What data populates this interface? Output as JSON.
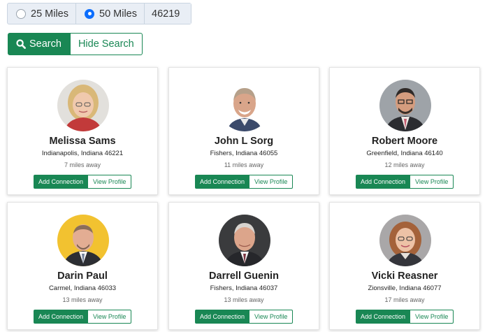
{
  "search_radius": {
    "options": [
      {
        "label": "25 Miles",
        "selected": false
      },
      {
        "label": "50 Miles",
        "selected": true
      }
    ],
    "zip_value": "46219"
  },
  "search_buttons": {
    "search_label": "Search",
    "hide_label": "Hide Search",
    "search_icon": "search-icon"
  },
  "colors": {
    "accent_green": "#198754",
    "radio_blue": "#0d6efd"
  },
  "results": [
    {
      "name": "Melissa Sams",
      "location": "Indianapolis, Indiana 46221",
      "distance": "7 miles away",
      "add_label": "Add Connection",
      "view_label": "View Profile"
    },
    {
      "name": "John L Sorg",
      "location": "Fishers, Indiana 46055",
      "distance": "11 miles away",
      "add_label": "Add Connection",
      "view_label": "View Profile"
    },
    {
      "name": "Robert Moore",
      "location": "Greenfield, Indiana 46140",
      "distance": "12 miles away",
      "add_label": "Add Connection",
      "view_label": "View Profile"
    },
    {
      "name": "Darin Paul",
      "location": "Carmel, Indiana 46033",
      "distance": "13 miles away",
      "add_label": "Add Connection",
      "view_label": "View Profile"
    },
    {
      "name": "Darrell Guenin",
      "location": "Fishers, Indiana 46037",
      "distance": "13 miles away",
      "add_label": "Add Connection",
      "view_label": "View Profile"
    },
    {
      "name": "Vicki Reasner",
      "location": "Zionsville, Indiana 46077",
      "distance": "17 miles away",
      "add_label": "Add Connection",
      "view_label": "View Profile"
    }
  ]
}
